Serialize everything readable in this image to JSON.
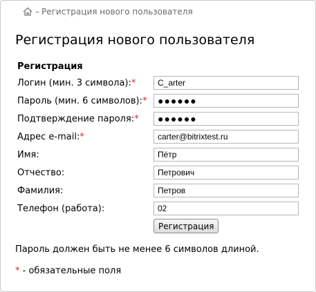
{
  "breadcrumb": {
    "separator": "–",
    "current": "Регистрация нового пользователя"
  },
  "page_title": "Регистрация нового пользователя",
  "form": {
    "section_title": "Регистрация",
    "required_mark": "*",
    "fields": [
      {
        "label": "Логин (мин. 3 символа):",
        "required": true,
        "value": "C_arter"
      },
      {
        "label": "Пароль (мин. 6 символов):",
        "required": true,
        "value": "●●●●●●"
      },
      {
        "label": "Подтверждение пароля:",
        "required": true,
        "value": "●●●●●●"
      },
      {
        "label": "Адрес e-mail:",
        "required": true,
        "value": "carter@bitrixtest.ru"
      },
      {
        "label": "Имя:",
        "required": false,
        "value": "Пётр"
      },
      {
        "label": "Отчество:",
        "required": false,
        "value": "Петрович"
      },
      {
        "label": "Фамилия:",
        "required": false,
        "value": "Петров"
      },
      {
        "label": "Телефон (работа):",
        "required": false,
        "value": "02"
      }
    ],
    "submit_label": "Регистрация"
  },
  "password_note": "Пароль должен быть не менее 6 символов длиной.",
  "required_note": {
    "mark": "*",
    "text": " - обязательные поля"
  },
  "colors": {
    "required_star": "#e02020",
    "breadcrumb_text": "#6b6b6b",
    "border": "#c9c9c9"
  },
  "icons": {
    "breadcrumb_home": "home-icon"
  }
}
